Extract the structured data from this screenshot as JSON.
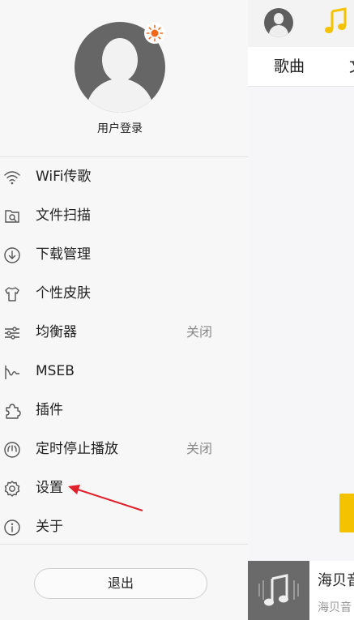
{
  "drawer": {
    "username": "用户登录",
    "menu": [
      {
        "label": "WiFi传歌",
        "icon": "wifi-icon"
      },
      {
        "label": "文件扫描",
        "icon": "scan-icon"
      },
      {
        "label": "下载管理",
        "icon": "download-icon"
      },
      {
        "label": "个性皮肤",
        "icon": "shirt-icon"
      },
      {
        "label": "均衡器",
        "icon": "equalizer-icon",
        "value": "关闭"
      },
      {
        "label": "MSEB",
        "icon": "waveform-icon"
      },
      {
        "label": "插件",
        "icon": "puzzle-icon"
      },
      {
        "label": "定时停止播放",
        "icon": "timer-icon",
        "value": "关闭"
      },
      {
        "label": "设置",
        "icon": "gear-icon"
      },
      {
        "label": "关于",
        "icon": "info-icon"
      }
    ],
    "logout_label": "退出"
  },
  "main": {
    "tabs": [
      "歌曲",
      "文"
    ],
    "player": {
      "title": "海贝音",
      "subtitle": "海贝音"
    }
  },
  "colors": {
    "accent": "#f5c200",
    "badge": "#ef6a1f",
    "annotation": "#e0202a"
  }
}
